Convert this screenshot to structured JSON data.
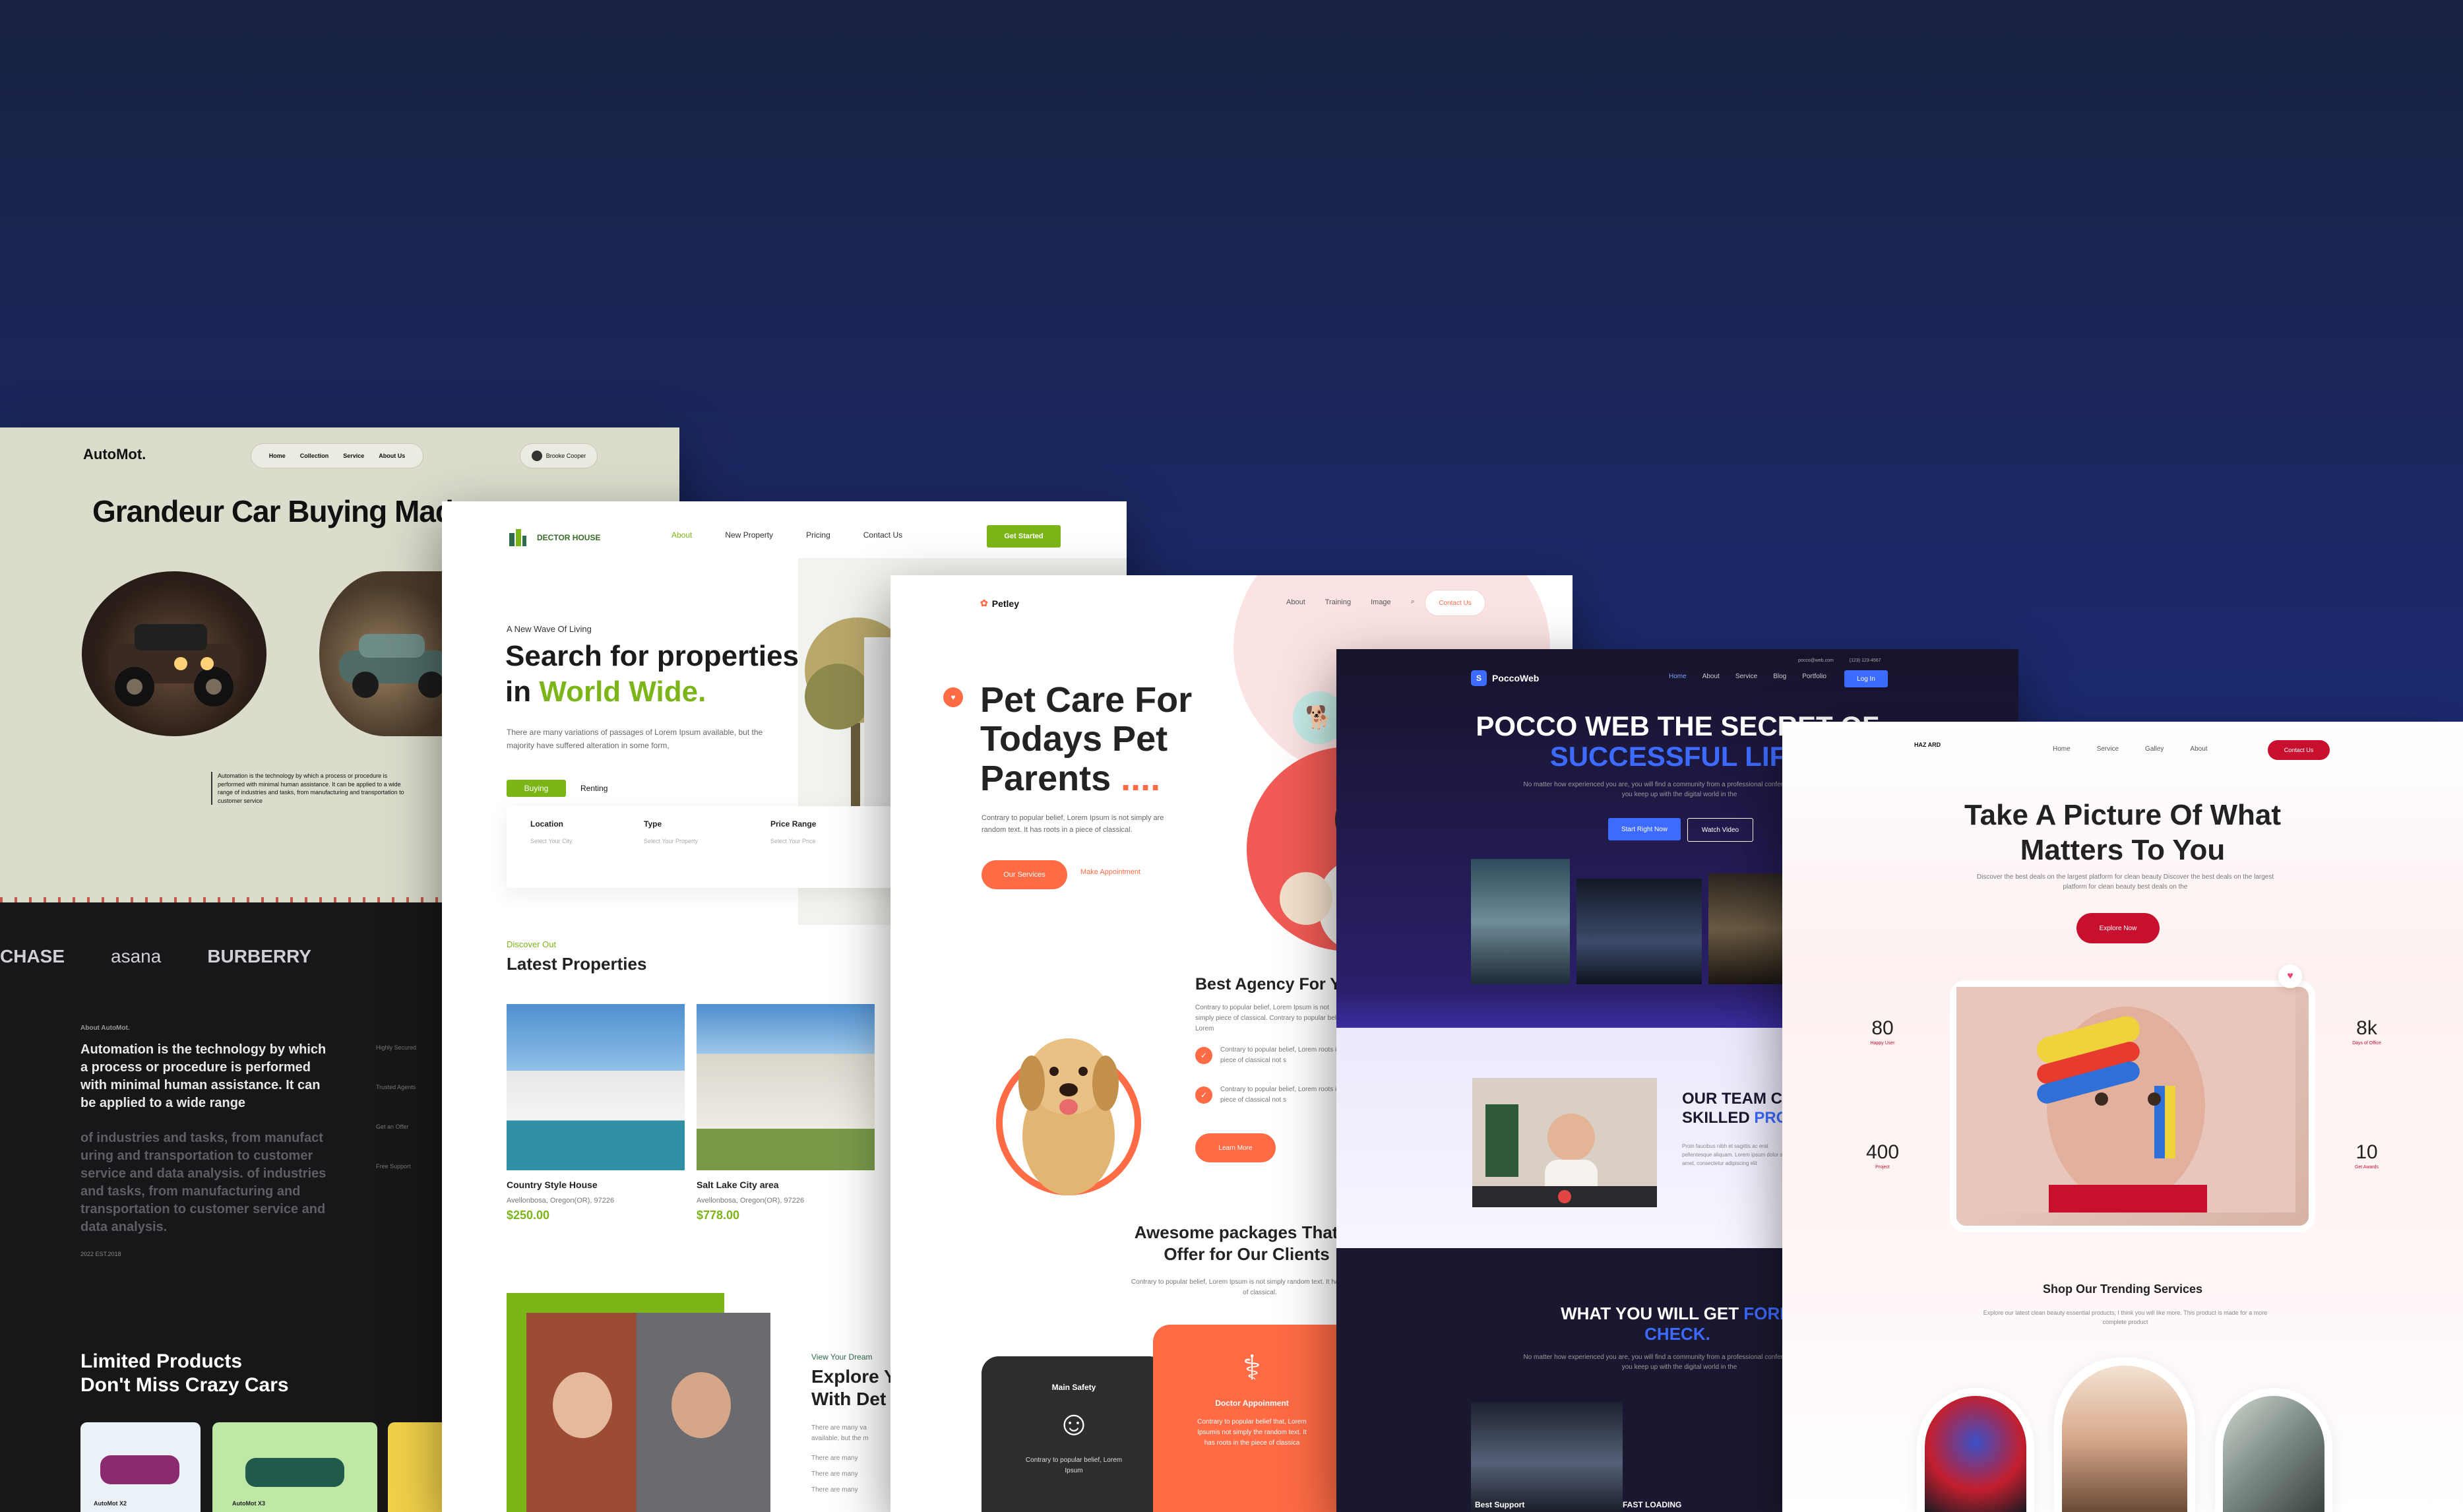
{
  "automot": {
    "logo": "AutoMot.",
    "nav": [
      "Home",
      "Collection",
      "Service",
      "About Us"
    ],
    "profile": "Brooke Cooper",
    "headline": "Grandeur Car Buying Made",
    "description": "Automation is the technology by which a process or procedure is performed with minimal human assistance. It can be applied to a wide range of industries and tasks, from manufacturing and transportation to customer service",
    "brands": [
      "CHASE",
      "asana",
      "BURBERRY"
    ],
    "about_label": "About AutoMot.",
    "about_bold": "Automation is the technology by which a process or procedure is performed with minimal human assistance. It can be applied to a wide range",
    "about_dim": "of industries and tasks, from manufact uring and transportation to customer service and data analysis. of industries and tasks, from manufacturing and transportation to customer service and data analysis.",
    "side_links": [
      "Highly Secured",
      "Trusted Agents",
      "Get an Offer",
      "Free Support"
    ],
    "since": "2022   EST.2018",
    "limited_title": "Limited Products",
    "limited_sub": "Don't Miss Crazy Cars",
    "mini_cards": [
      "AutoMot X2",
      "AutoMot X3"
    ]
  },
  "house": {
    "logo": "DECTOR HOUSE",
    "nav": [
      "About",
      "New Property",
      "Pricing",
      "Contact Us"
    ],
    "cta": "Get Started",
    "eyebrow": "A New Wave Of Living",
    "title_1": "Search for properties",
    "title_2": "in ",
    "title_green": "World Wide.",
    "sub": "There are many variations of passages of Lorem Ipsum available, but the majority have suffered alteration in some form,",
    "tabs": [
      "Buying",
      "Renting"
    ],
    "fields": [
      {
        "label": "Location",
        "value": "Select Your City"
      },
      {
        "label": "Type",
        "value": "Select Your Property"
      },
      {
        "label": "Price Range",
        "value": "Select Your Price"
      }
    ],
    "discover": "Discover Out",
    "latest": "Latest Properties",
    "properties": [
      {
        "name": "Country Style House",
        "addr": "Avellonbosa, Oregon(OR), 97226",
        "price": "$250.00"
      },
      {
        "name": "Salt Lake City area",
        "addr": "Avellonbosa, Oregon(OR), 97226",
        "price": "$778.00"
      }
    ],
    "dreams_eyebrow": "View Your Dream",
    "dreams_title_1": "Explore Y",
    "dreams_title_2": "With Det",
    "dreams_sub": "There are many va available, but the m",
    "dreams_items": [
      "There are many",
      "There are many",
      "There are many"
    ]
  },
  "pet": {
    "logo": "Petley",
    "nav": [
      "About",
      "Training",
      "Image"
    ],
    "cta": "Contact Us",
    "title_1": "Pet Care For",
    "title_2": "Todays Pet",
    "title_3": "Parents",
    "title_dots": "....",
    "sub": "Contrary to popular belief, Lorem Ipsum is not simply are random text. It has roots in a piece of classical.",
    "btn_services": "Our Services",
    "btn_appointment": "Make Appointment",
    "agency": "Best Agency For Y",
    "agency_sub": "Contrary to popular belief, Lorem Ipsum is not simply piece of classical. Contrary to popular belief, Lorem",
    "agency_items": [
      "Contrary to popular belief, Lorem roots in a piece of classical not s",
      "Contrary to popular belief, Lorem roots in a piece of classical not s"
    ],
    "learn": "Learn More",
    "packages_1": "Awesome packages That W",
    "packages_2": "Offer for Our Clients",
    "packages_sub": "Contrary to popular belief, Lorem Ipsum is not simply random text. It has roots in a piece of classical.",
    "card_dark_title": "Main Safety",
    "card_dark_text": "Contrary to popular belief, Lorem Ipsum",
    "card_orange_title": "Doctor Appoinment",
    "card_orange_text": "Contrary to popular belief that, Lorem Ipsumis not simply the random text. It has roots in the piece of classica"
  },
  "pocco": {
    "logo": "PoccoWeb",
    "nav": [
      "Home",
      "About",
      "Service",
      "Blog",
      "Portfolio"
    ],
    "contact": [
      "pocco@web.com",
      "(123) 123-4567"
    ],
    "login": "Log In",
    "title_1": "POCCO WEB THE SECRET OF",
    "title_2": "SUCCESSFUL LIFE",
    "sub": "No matter how experienced you are, you will find a community from a professional conference that will help you keep up with the digital world in the",
    "btn_start": "Start Right Now",
    "btn_watch": "Watch Video",
    "team_1": "OUR TEAM CO",
    "team_2": "SKILLED ",
    "team_blue": "PRO",
    "team_sub": "Proin faucibus nibh et sagittis ac erat pellentesque aliquam. Lorem ipsum dolor sit amet, consectetur adipiscing elit",
    "what_1": "WHAT YOU WILL GET ",
    "what_blue": "FORM",
    "what_2": "CHECK.",
    "what_sub": "No matter how experienced you are, you will find a community from a professional conference that will help you keep up with the digital world in the",
    "footer_labels": [
      "Best Support",
      "FAST LOADING"
    ]
  },
  "photo": {
    "logo": "HAZ ARD",
    "nav": [
      "Home",
      "Service",
      "Galley",
      "About"
    ],
    "cta": "Contact Us",
    "title_1": "Take A Picture Of What",
    "title_2": "Matters To You",
    "sub": "Discover the best deals on the largest platform for clean beauty Discover the best deals on the largest platform for clean beauty best deals on the",
    "explore": "Explore Now",
    "stats": [
      {
        "n": "80",
        "l": "Happy User"
      },
      {
        "n": "8k",
        "l": "Days of Office"
      },
      {
        "n": "400",
        "l": "Project"
      },
      {
        "n": "10",
        "l": "Get Awards"
      }
    ],
    "trend": "Shop Our Trending Services",
    "trend_sub": "Explore our latest clean beauty essential products, I think you will like more. This product is made for a more complete product"
  },
  "colors": {
    "background_top": "#182140",
    "background_bottom": "#1f2f9a",
    "house_green": "#7cb518",
    "pet_orange": "#ff6b45",
    "pocco_blue": "#3d6bff",
    "photo_red": "#c8102e"
  }
}
